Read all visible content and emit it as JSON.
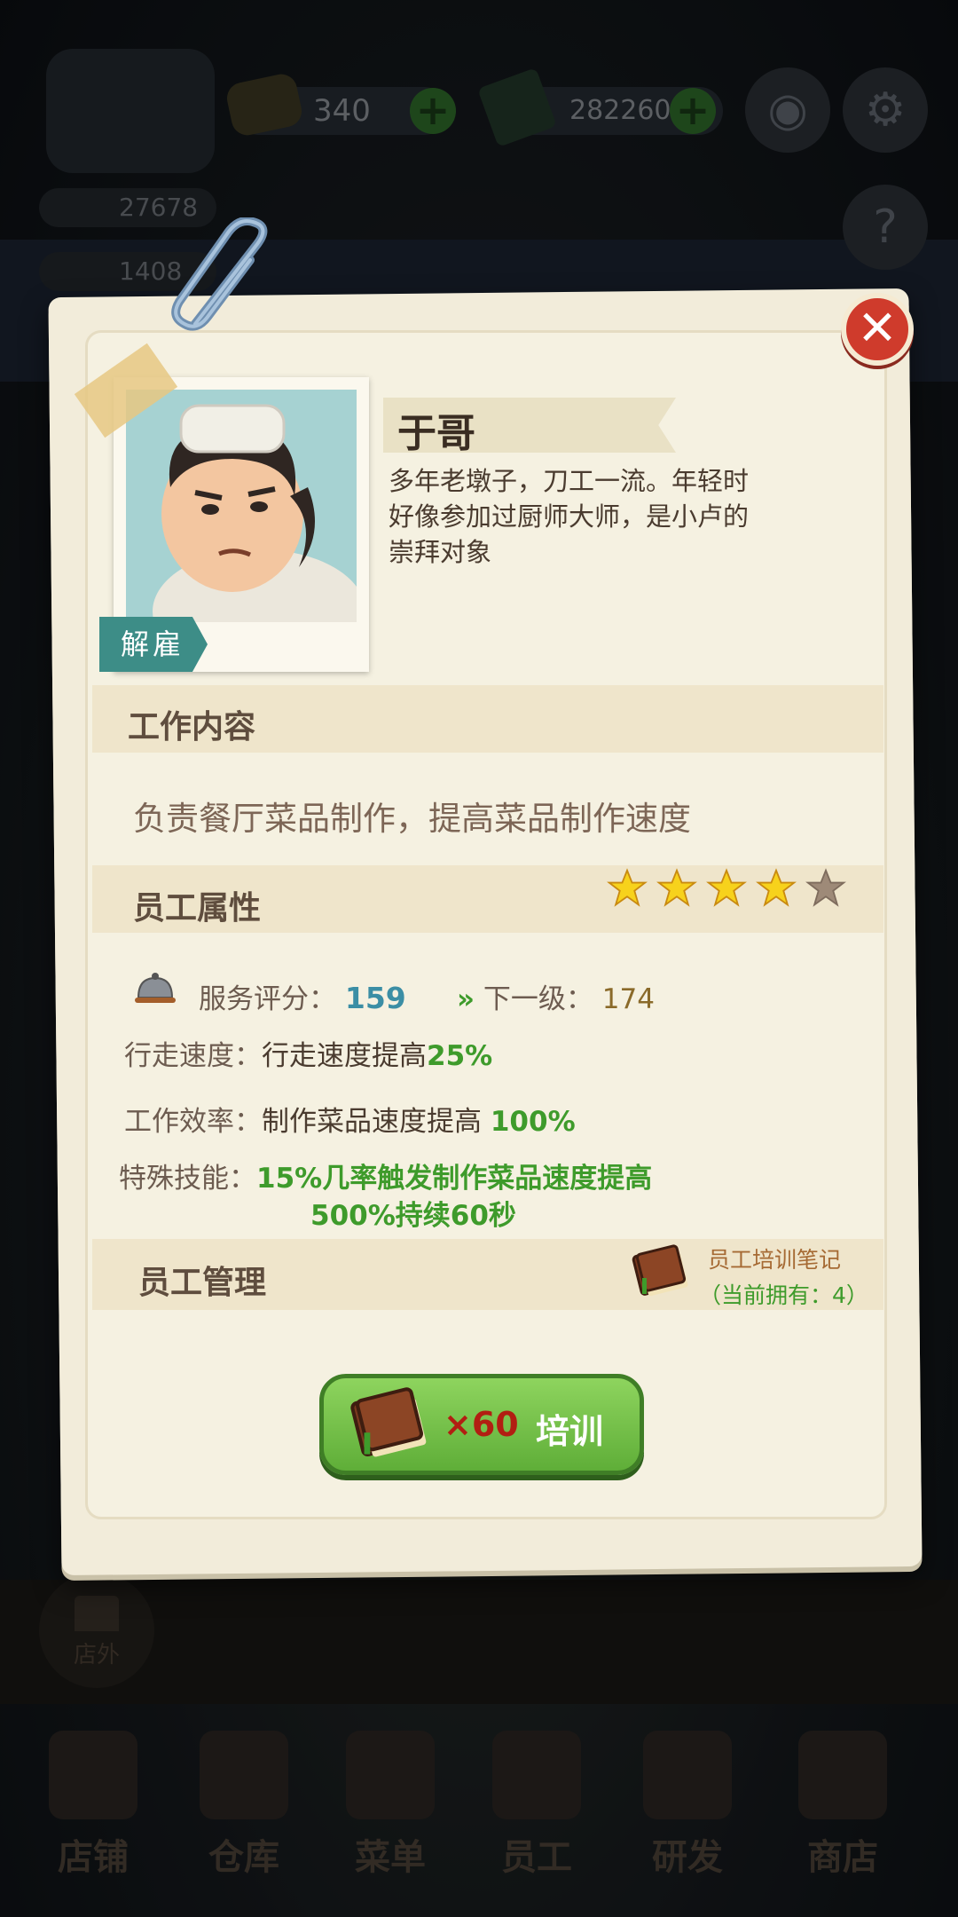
{
  "hud": {
    "coins": "340",
    "cash": "2822600",
    "stat1": "27678",
    "stat2": "1408"
  },
  "side": {
    "store_out_label": "店外"
  },
  "bottom_nav": [
    {
      "label": "店铺"
    },
    {
      "label": "仓库"
    },
    {
      "label": "菜单"
    },
    {
      "label": "员工"
    },
    {
      "label": "研发"
    },
    {
      "label": "商店"
    }
  ],
  "dialog": {
    "fire_label": "解雇",
    "employee_name": "于哥",
    "description": "多年老墩子，刀工一流。年轻时好像参加过厨师大师，是小卢的崇拜对象",
    "work_section_title": "工作内容",
    "work_text": "负责餐厅菜品制作，提高菜品制作速度",
    "attr_section_title": "员工属性",
    "stars_filled": 4,
    "stars_total": 5,
    "service_rating_label": "服务评分：",
    "service_rating_value": "159",
    "next_level_label": "下一级：",
    "next_level_value": "174",
    "walk_speed_label": "行走速度：",
    "walk_speed_text": "行走速度提高",
    "walk_speed_value": "25%",
    "efficiency_label": "工作效率：",
    "efficiency_text": "制作菜品速度提高",
    "efficiency_value": "100%",
    "skill_label": "特殊技能：",
    "skill_line1": "15%几率触发制作菜品速度提高",
    "skill_line2": "500%持续60秒",
    "mgmt_section_title": "员工管理",
    "notes_label": "员工培训笔记",
    "notes_count": "（当前拥有：4）",
    "train_cost": "×60",
    "train_label": "培训"
  },
  "colors": {
    "accent_green": "#3e9b2b",
    "rating_blue": "#3b8ea5",
    "close_red": "#cf3b2c",
    "paper": "#f5f1e1"
  }
}
